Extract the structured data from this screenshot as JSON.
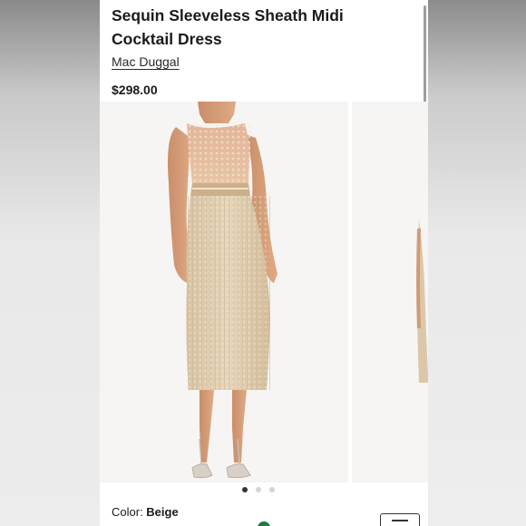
{
  "product": {
    "title_line1": "Sequin Sleeveless Sheath Midi",
    "title_line2": "Cocktail Dress",
    "brand": "Mac Duggal",
    "price": "$298.00"
  },
  "carousel": {
    "slide_count": 3,
    "active_index": 0
  },
  "color": {
    "label": "Color:",
    "value": "Beige"
  },
  "icons": {
    "menu": "hamburger-icon",
    "badge": "green-circle-icon"
  }
}
